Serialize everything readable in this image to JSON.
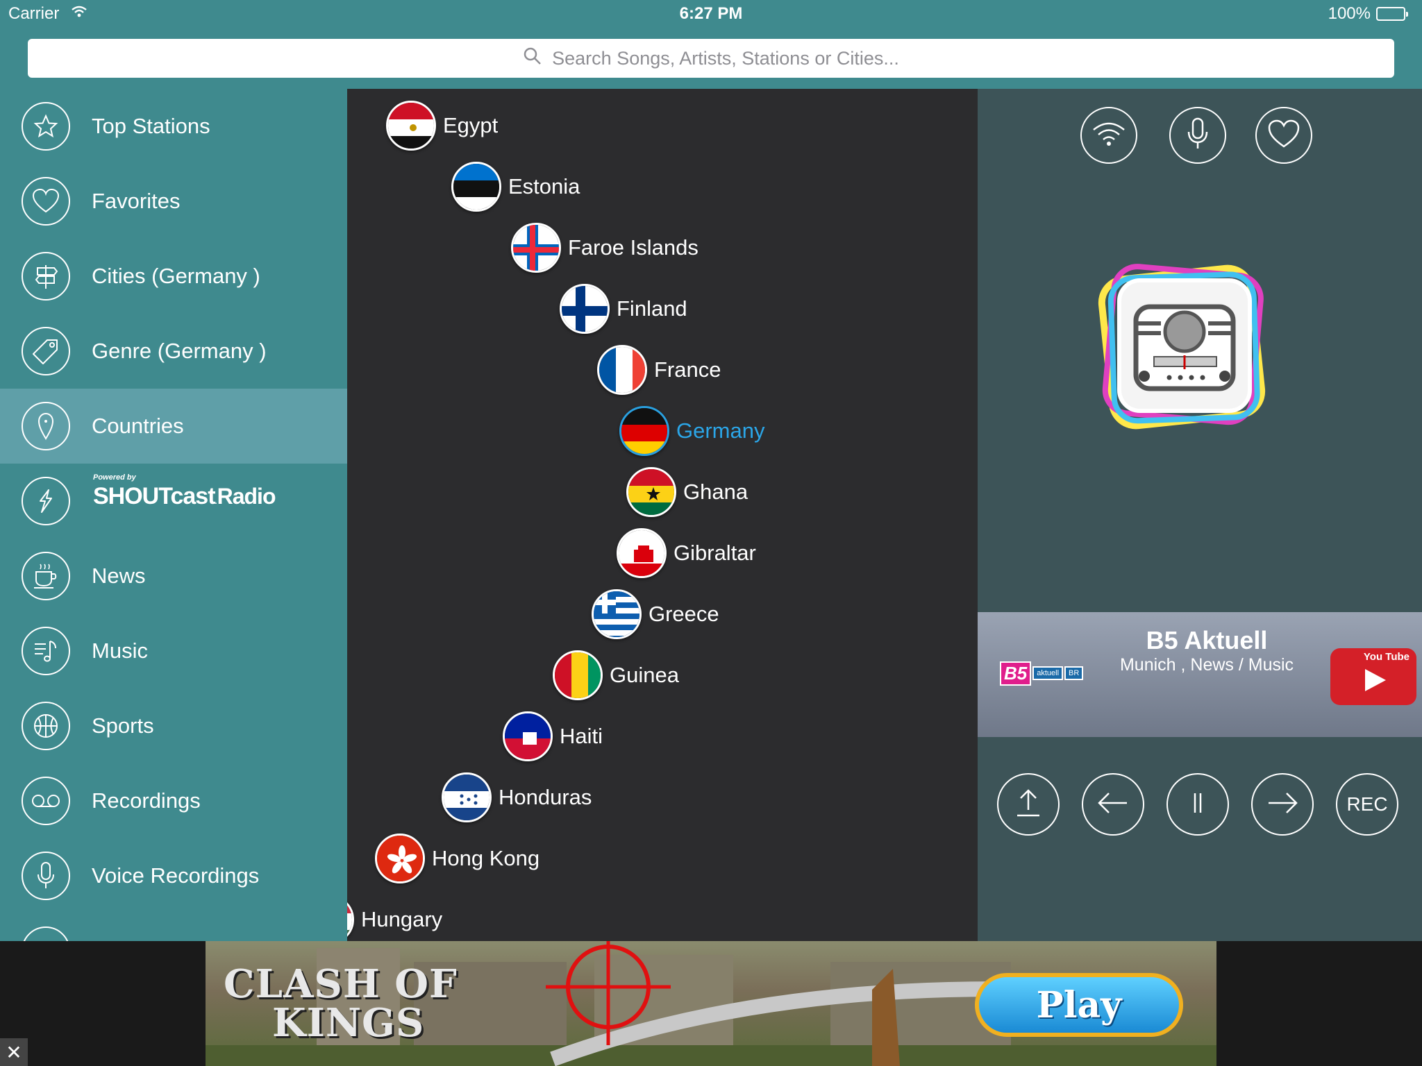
{
  "status": {
    "carrier": "Carrier",
    "time": "6:27 PM",
    "battery": "100%"
  },
  "search": {
    "placeholder": "Search Songs, Artists, Stations or Cities..."
  },
  "sidebar": {
    "items": [
      {
        "label": "Top Stations",
        "icon": "star-icon"
      },
      {
        "label": "Favorites",
        "icon": "heart-icon"
      },
      {
        "label": "Cities  (Germany )",
        "icon": "signpost-icon"
      },
      {
        "label": "Genre  (Germany )",
        "icon": "tag-icon"
      },
      {
        "label": "Countries",
        "icon": "map-pin-icon",
        "active": true
      },
      {
        "label": "",
        "icon": "shoutcast-icon"
      },
      {
        "label": "News",
        "icon": "coffee-cup-icon"
      },
      {
        "label": "Music",
        "icon": "music-list-icon"
      },
      {
        "label": "Sports",
        "icon": "basketball-icon"
      },
      {
        "label": "Recordings",
        "icon": "voicemail-icon"
      },
      {
        "label": "Voice Recordings",
        "icon": "microphone-icon"
      }
    ],
    "shoutcast": {
      "powered_by": "Powered by",
      "brand": "SHOUTcast",
      "brand_suffix": "Radio"
    }
  },
  "countries": {
    "selected": "Germany",
    "items": [
      "Egypt",
      "Estonia",
      "Faroe Islands",
      "Finland",
      "France",
      "Germany",
      "Ghana",
      "Gibraltar",
      "Greece",
      "Guinea",
      "Haiti",
      "Honduras",
      "Hong Kong",
      "Hungary"
    ]
  },
  "player": {
    "top_buttons": [
      "wifi-icon",
      "microphone-icon",
      "heart-icon"
    ],
    "station": {
      "name": "B5 Aktuell",
      "subtitle": "Munich , News / Music",
      "logo_main": "B5",
      "logo_sub": "aktuell",
      "logo_mark": "BR"
    },
    "youtube": {
      "label": "You Tube"
    },
    "controls": {
      "rec_label": "REC"
    }
  },
  "ad": {
    "title_line1": "CLASH OF",
    "title_line2": "KINGS",
    "play_label": "Play",
    "close": "✕"
  },
  "colors": {
    "teal": "#3f8a8e",
    "active_item": "#5f9fa8",
    "list_bg": "#2c2c2e",
    "selected_blue": "#2ba6e8",
    "player_bg": "#3d5458"
  }
}
